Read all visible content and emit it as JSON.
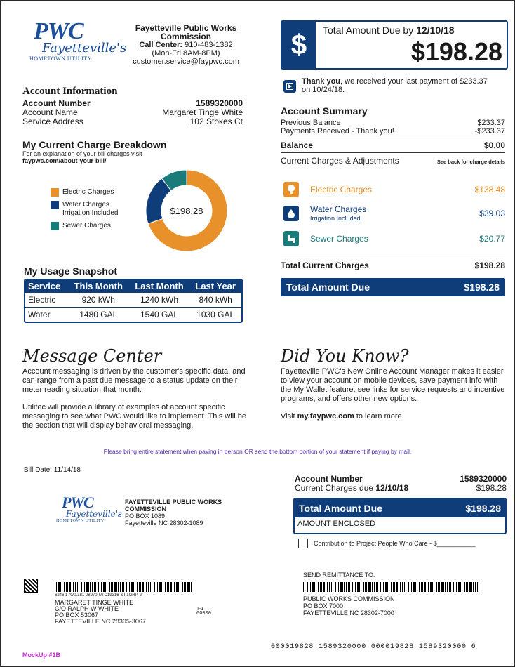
{
  "header": {
    "logo_text": "PWC",
    "logo_sub": "Fayetteville's",
    "logo_tag": "HOMETOWN UTILITY",
    "org_name_1": "Fayetteville Public Works",
    "org_name_2": "Commission",
    "call_label": "Call Center:",
    "call_number": "910-483-1382",
    "hours": "(Mon-Fri 8AM-8PM)",
    "email": "customer.service@faypwc.com"
  },
  "account_info": {
    "heading": "Account Information",
    "number_label": "Account Number",
    "number_value": "1589320000",
    "name_label": "Account Name",
    "name_value": "Margaret Tinge White",
    "address_label": "Service Address",
    "address_value": "102 Stokes Ct"
  },
  "breakdown": {
    "heading": "My Current Charge Breakdown",
    "note": "For an explanation of your bill charges visit",
    "link": "faypwc.com/about-your-bill/",
    "center_label": "$198.28",
    "legend": [
      {
        "label": "Electric Charges",
        "color": "#e8902a"
      },
      {
        "label": "Water Charges",
        "label2": "Irrigation Included",
        "color": "#0e3d7a"
      },
      {
        "label": "Sewer Charges",
        "color": "#1b7b7b"
      }
    ]
  },
  "chart_data": {
    "type": "pie",
    "title": "",
    "categories": [
      "Electric Charges",
      "Water Charges",
      "Sewer Charges"
    ],
    "values": [
      138.48,
      39.03,
      20.77
    ],
    "colors": [
      "#e8902a",
      "#0e3d7a",
      "#1b7b7b"
    ],
    "donut": true,
    "center_text": "$198.28"
  },
  "usage": {
    "heading": "My Usage Snapshot",
    "columns": [
      "Service",
      "This Month",
      "Last Month",
      "Last Year"
    ],
    "rows": [
      [
        "Electric",
        "920 kWh",
        "1240 kWh",
        "840 kWh"
      ],
      [
        "Water",
        "1480 GAL",
        "1540 GAL",
        "1030 GAL"
      ]
    ]
  },
  "total_box": {
    "icon": "dollar-icon",
    "label": "Total Amount Due",
    "by": "by",
    "date": "12/10/18",
    "amount": "$198.28"
  },
  "thanks": {
    "icon": "play-icon",
    "bold": "Thank you",
    "text": ", we received your last payment of $233.37",
    "text2": "on 10/24/18."
  },
  "summary": {
    "heading": "Account Summary",
    "prev_label": "Previous Balance",
    "prev_value": "$233.37",
    "paid_label": "Payments Received - Thank you!",
    "paid_value": "-$233.37",
    "balance_label": "Balance",
    "balance_value": "$0.00",
    "current_heading": "Current Charges & Adjustments",
    "see_back": "See back for charge details",
    "charges": [
      {
        "icon": "lightbulb-icon",
        "label": "Electric Charges",
        "sub": "",
        "value": "$138.48",
        "color": "#e8902a"
      },
      {
        "icon": "water-drop-icon",
        "label": "Water Charges",
        "sub": "Irrigation Included",
        "value": "$39.03",
        "color": "#0e3d7a"
      },
      {
        "icon": "pipe-icon",
        "label": "Sewer Charges",
        "sub": "",
        "value": "$20.77",
        "color": "#1b7b7b"
      }
    ],
    "total_current_label": "Total Current Charges",
    "total_current_value": "$198.28",
    "total_due_label": "Total Amount Due",
    "total_due_value": "$198.28"
  },
  "messages": {
    "heading": "Message Center",
    "p1": "Account messaging is driven by the customer's specific data, and can range from a past due message to a status update on their meter reading situation that month.",
    "p2": "Utilitec will provide a library of examples of account specific messaging to see what PWC would like to implement. This will be the section that will display behavioral messaging."
  },
  "dyk": {
    "heading": "Did You Know?",
    "p1": "Fayetteville PWC's New Online Account Manager makes it easier to view your account on mobile devices, save payment info with the My Wallet feature, see links for service requests and incentive programs, and offers other new options.",
    "visit": "Visit",
    "link": "my.faypwc.com",
    "after": "to learn more."
  },
  "notice": "Please bring entire statement when paying in person OR send the bottom portion of your statement if paying by mail.",
  "stub": {
    "bill_date": "Bill Date: 11/14/18",
    "org_1": "FAYETTEVILLE PUBLIC WORKS",
    "org_2": "COMMISSION",
    "po": "PO BOX 1089",
    "city": "Fayetteville NC 28302-1089",
    "acct_label": "Account Number",
    "acct_value": "1589320000",
    "due_label": "Current Charges due",
    "due_date": "12/10/18",
    "due_value": "$198.28",
    "total_label": "Total Amount Due",
    "total_value": "$198.28",
    "enclosed": "AMOUNT ENCLOSED",
    "contribution": "Contribution to Project People Who Care - $___________",
    "scan_line": "6246 1 AV0.381 08970-UTC19316-ST.1GRP-2",
    "addr1": "MARGARET TINGE WHITE",
    "addr2": "C/O RALPH W WHITE",
    "addr3": "PO BOX 53067",
    "addr4": "FAYETTEVILLE NC 28305-3067",
    "t1": "T-1",
    "t1code": "00000",
    "remit_label": "SEND REMITTANCE TO:",
    "remit1": "PUBLIC WORKS COMMISSION",
    "remit2": "PO BOX 7000",
    "remit3": "FAYETTEVILLE NC 28302-7000",
    "ocr": "000019828 1589320000 000019828 1589320000 6",
    "mockup": "MockUp #1B"
  }
}
